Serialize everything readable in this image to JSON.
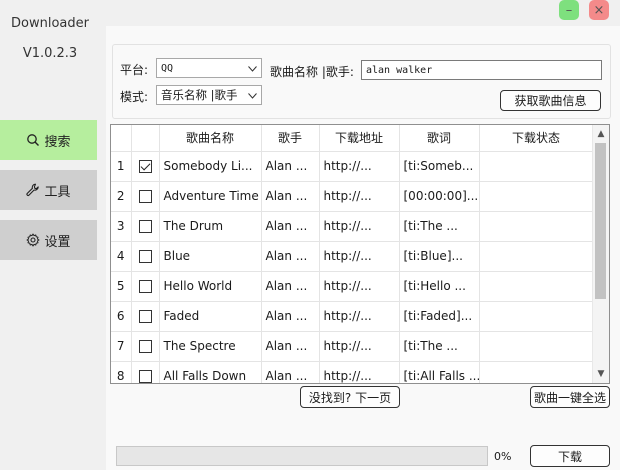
{
  "app": {
    "title": "Downloader",
    "version": "V1.0.2.3"
  },
  "window": {
    "minimize": "–",
    "close": "×"
  },
  "nav": [
    {
      "id": "search",
      "label": "搜索",
      "icon": "search-icon",
      "active": true
    },
    {
      "id": "tools",
      "label": "工具",
      "icon": "wrench-icon",
      "active": false
    },
    {
      "id": "settings",
      "label": "设置",
      "icon": "gear-icon",
      "active": false
    }
  ],
  "form": {
    "platform_label": "平台:",
    "platform_value": "QQ",
    "mode_label": "模式:",
    "mode_value": "音乐名称 |歌手",
    "query_label": "歌曲名称 |歌手:",
    "query_value": "alan walker",
    "fetch_button": "获取歌曲信息"
  },
  "table": {
    "columns": [
      "歌曲名称",
      "歌手",
      "下载地址",
      "歌词",
      "下载状态"
    ],
    "rows": [
      {
        "n": "1",
        "checked": true,
        "name": "Somebody Li...",
        "artist": "Alan ...",
        "url": "http://...",
        "lyrics": "[ti:Someb...",
        "status": ""
      },
      {
        "n": "2",
        "checked": false,
        "name": "Adventure Time",
        "artist": "Alan ...",
        "url": "http://...",
        "lyrics": "[00:00:00]...",
        "status": ""
      },
      {
        "n": "3",
        "checked": false,
        "name": "The Drum",
        "artist": "Alan ...",
        "url": "http://...",
        "lyrics": "[ti:The ...",
        "status": ""
      },
      {
        "n": "4",
        "checked": false,
        "name": "Blue",
        "artist": "Alan ...",
        "url": "http://...",
        "lyrics": "[ti:Blue]...",
        "status": ""
      },
      {
        "n": "5",
        "checked": false,
        "name": "Hello World",
        "artist": "Alan ...",
        "url": "http://...",
        "lyrics": "[ti:Hello ...",
        "status": ""
      },
      {
        "n": "6",
        "checked": false,
        "name": "Faded",
        "artist": "Alan ...",
        "url": "http://...",
        "lyrics": "[ti:Faded]...",
        "status": ""
      },
      {
        "n": "7",
        "checked": false,
        "name": "The Spectre",
        "artist": "Alan ...",
        "url": "http://...",
        "lyrics": "[ti:The ...",
        "status": ""
      },
      {
        "n": "8",
        "checked": false,
        "name": "All Falls Down",
        "artist": "Alan ...",
        "url": "http://...",
        "lyrics": "[ti:All Falls ...",
        "status": ""
      }
    ]
  },
  "actions": {
    "next_page": "没找到? 下一页",
    "select_all": "歌曲一键全选",
    "download": "下载"
  },
  "progress": {
    "value": 0,
    "label": "0%"
  },
  "colors": {
    "nav_active": "#b6ee9e",
    "nav_inactive": "#cfcfcf",
    "minimize": "#7ee07e",
    "close": "#f48a8a",
    "progress": "#06b025"
  }
}
